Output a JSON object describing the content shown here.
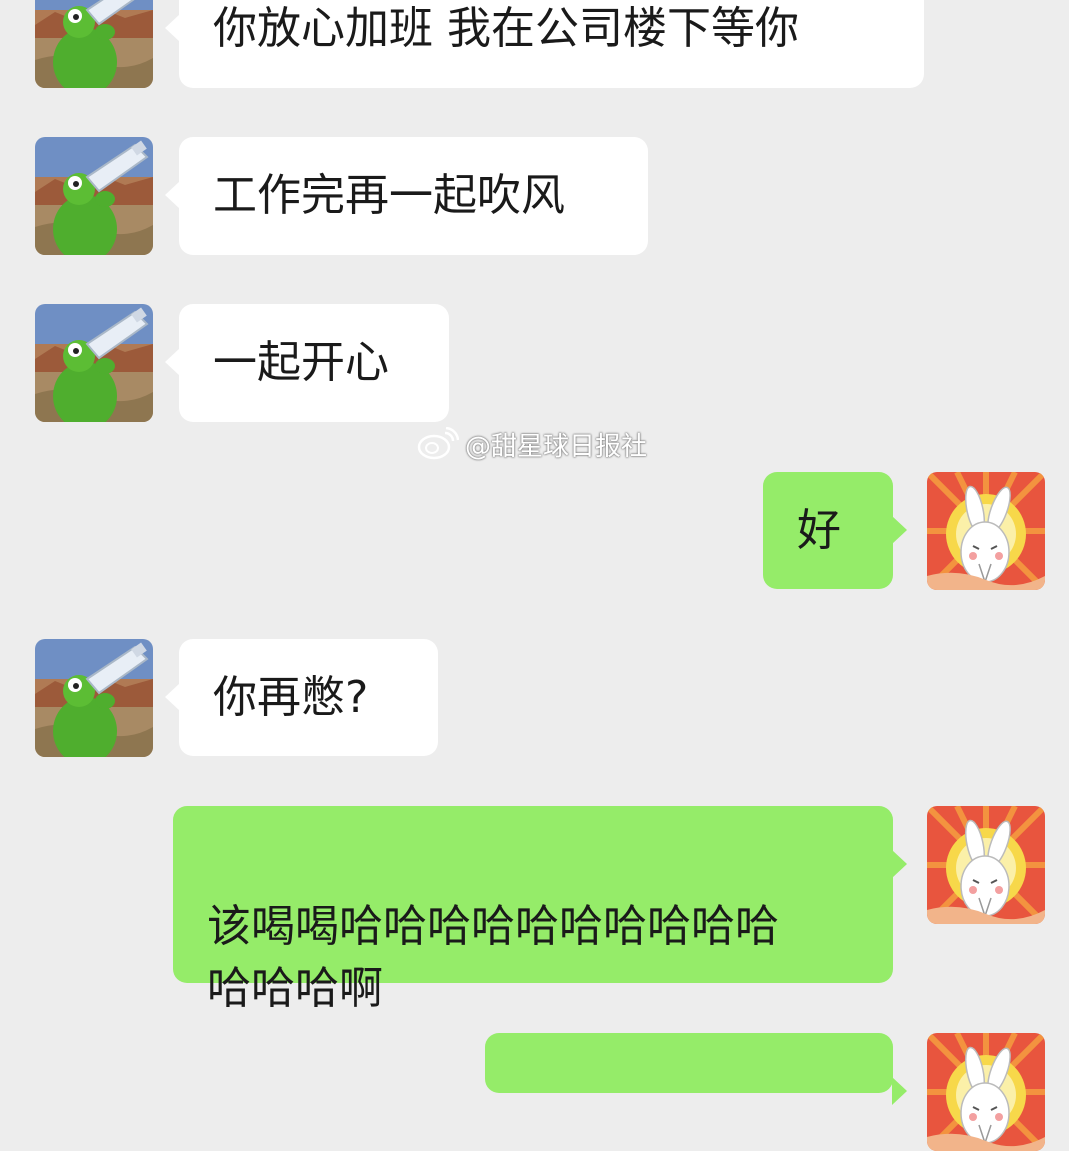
{
  "chat": {
    "messages": [
      {
        "side": "in",
        "text": "你放心加班 我在公司楼下等你",
        "avatar": "kermit-drinking-avatar"
      },
      {
        "side": "in",
        "text": "工作完再一起吹风",
        "avatar": "kermit-drinking-avatar"
      },
      {
        "side": "in",
        "text": "一起开心",
        "avatar": "kermit-drinking-avatar"
      },
      {
        "side": "out",
        "text": "好",
        "avatar": "praying-bunny-avatar"
      },
      {
        "side": "in",
        "text": "你再憋?",
        "avatar": "kermit-drinking-avatar"
      },
      {
        "side": "out",
        "text": "该喝喝哈哈哈哈哈哈哈哈哈哈\n哈哈哈啊",
        "avatar": "praying-bunny-avatar"
      },
      {
        "side": "out",
        "text": "",
        "avatar": "praying-bunny-avatar"
      }
    ]
  },
  "watermark": {
    "text": "@甜星球日报社",
    "icon": "weibo-icon"
  },
  "colors": {
    "background": "#ededed",
    "incoming_bubble": "#ffffff",
    "outgoing_bubble": "#95ec69"
  }
}
